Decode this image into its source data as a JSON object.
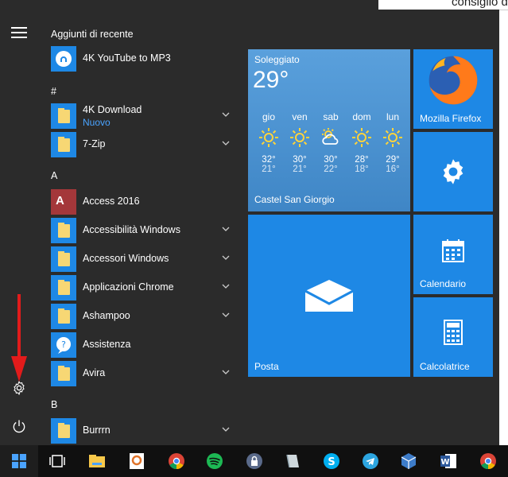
{
  "background_doc": {
    "snippet": "consiglio d"
  },
  "rail": {
    "menu_icon": "hamburger-icon",
    "settings_icon": "gear-icon",
    "power_icon": "power-icon"
  },
  "applist": {
    "recent_title": "Aggiunti di recente",
    "letters": [
      "#",
      "A",
      "B"
    ],
    "apps": [
      {
        "name": "4K YouTube to MP3"
      },
      {
        "name": "4K Download",
        "sub": "Nuovo"
      },
      {
        "name": "7-Zip"
      },
      {
        "name": "Access 2016"
      },
      {
        "name": "Accessibilità Windows"
      },
      {
        "name": "Accessori Windows"
      },
      {
        "name": "Applicazioni Chrome"
      },
      {
        "name": "Ashampoo"
      },
      {
        "name": "Assistenza"
      },
      {
        "name": "Avira"
      },
      {
        "name": "Burrrn"
      }
    ]
  },
  "weather": {
    "condition": "Soleggiato",
    "temp": "29°",
    "days": [
      {
        "d": "gio",
        "hi": "32°",
        "lo": "21°",
        "icon": "sun-icon"
      },
      {
        "d": "ven",
        "hi": "30°",
        "lo": "21°",
        "icon": "sun-icon"
      },
      {
        "d": "sab",
        "hi": "30°",
        "lo": "22°",
        "icon": "partly-cloudy-icon"
      },
      {
        "d": "dom",
        "hi": "28°",
        "lo": "18°",
        "icon": "sun-icon"
      },
      {
        "d": "lun",
        "hi": "29°",
        "lo": "16°",
        "icon": "sun-icon"
      }
    ],
    "place": "Castel San Giorgio"
  },
  "tiles": {
    "firefox": "Mozilla Firefox",
    "posta": "Posta",
    "calendario": "Calendario",
    "calcolatrice": "Calcolatrice"
  },
  "colors": {
    "accent": "#1e88e5",
    "start_bg": "#2b2b2b",
    "taskbar": "#101010",
    "arrow": "#e21b1b"
  }
}
